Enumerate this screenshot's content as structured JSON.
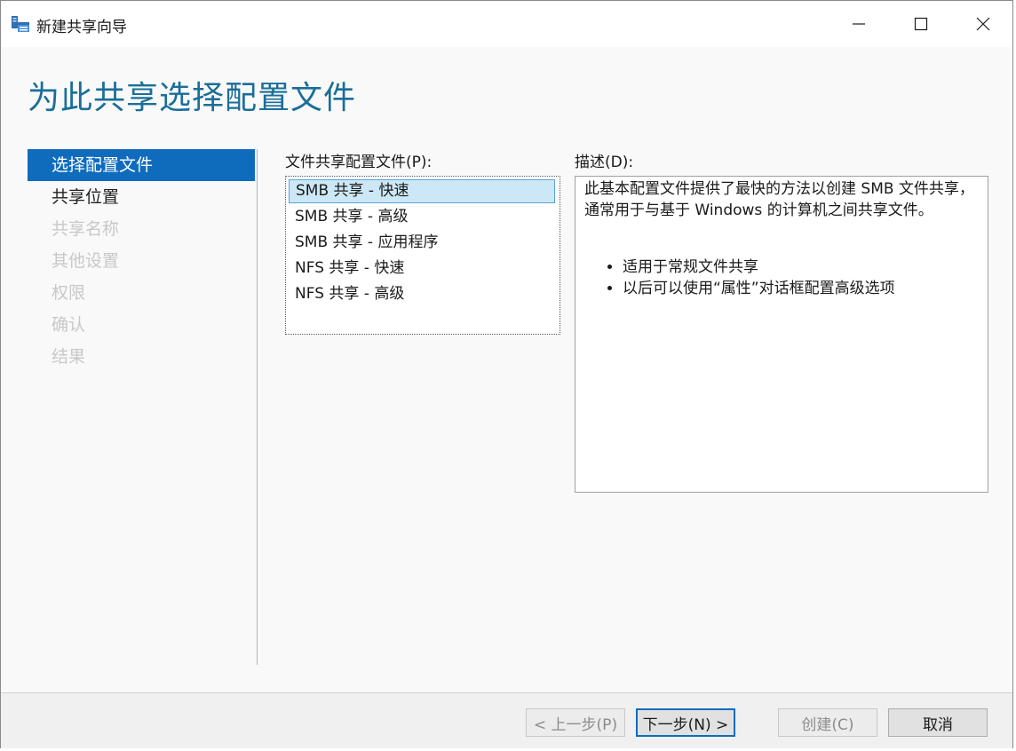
{
  "window": {
    "title": "新建共享向导",
    "controls": [
      "minimize-icon",
      "maximize-icon",
      "close-icon"
    ]
  },
  "page": {
    "title": "为此共享选择配置文件"
  },
  "nav": {
    "items": [
      {
        "label": "选择配置文件",
        "state": "active"
      },
      {
        "label": "共享位置",
        "state": "enabled"
      },
      {
        "label": "共享名称",
        "state": "disabled"
      },
      {
        "label": "其他设置",
        "state": "disabled"
      },
      {
        "label": "权限",
        "state": "disabled"
      },
      {
        "label": "确认",
        "state": "disabled"
      },
      {
        "label": "结果",
        "state": "disabled"
      }
    ]
  },
  "profiles": {
    "label": "文件共享配置文件(P):",
    "items": [
      {
        "label": "SMB 共享 - 快速",
        "selected": true
      },
      {
        "label": "SMB 共享 - 高级",
        "selected": false
      },
      {
        "label": "SMB 共享 - 应用程序",
        "selected": false
      },
      {
        "label": "NFS 共享 - 快速",
        "selected": false
      },
      {
        "label": "NFS 共享 - 高级",
        "selected": false
      }
    ]
  },
  "description": {
    "label": "描述(D):",
    "text": "此基本配置文件提供了最快的方法以创建 SMB 文件共享，通常用于与基于 Windows 的计算机之间共享文件。",
    "bullets": [
      "适用于常规文件共享",
      "以后可以使用“属性”对话框配置高级选项"
    ]
  },
  "buttons": {
    "prev": "< 上一步(P)",
    "next": "下一步(N) >",
    "create": "创建(C)",
    "cancel": "取消"
  },
  "colors": {
    "accent": "#0f6cbd",
    "title": "#1a6e99",
    "selection": "#cce8f7"
  }
}
